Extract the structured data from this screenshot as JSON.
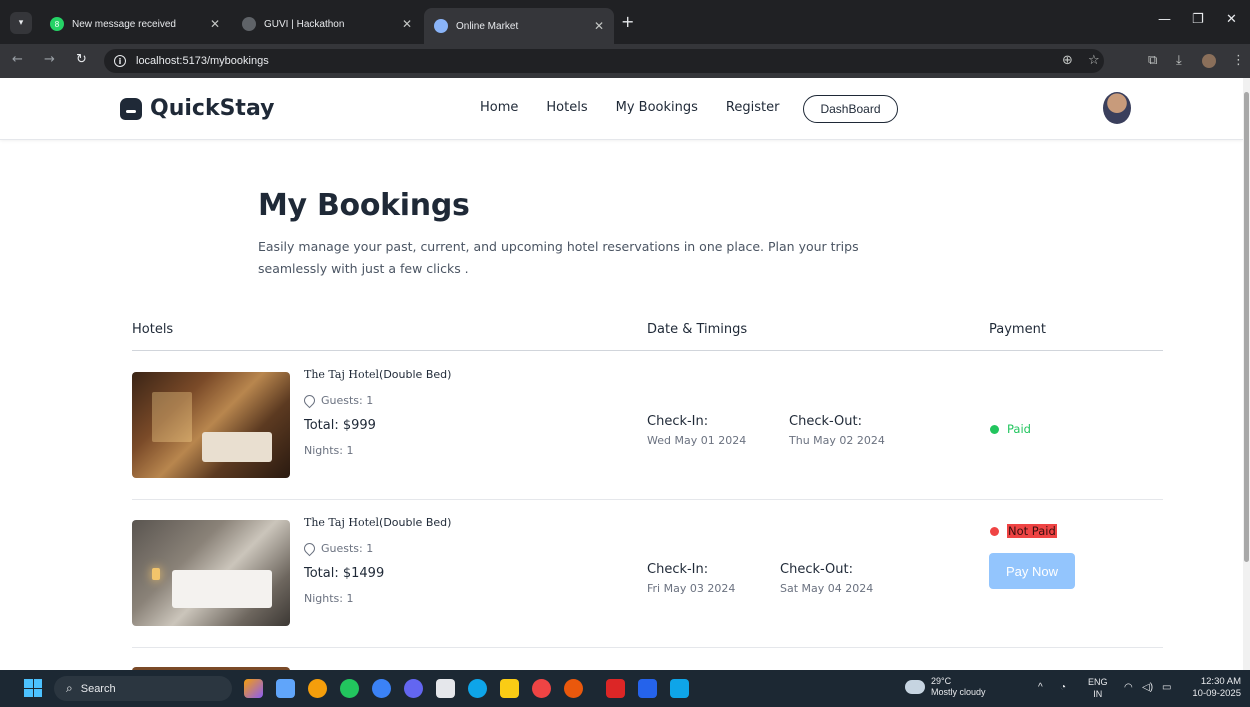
{
  "browser": {
    "tabs": [
      {
        "title": "New message received",
        "favicon_color": "#25d366",
        "favicon_text": "8"
      },
      {
        "title": "GUVI | Hackathon",
        "favicon_color": "#5f6368",
        "favicon_text": ""
      },
      {
        "title": "Online Market",
        "favicon_color": "#8ab4f8",
        "favicon_text": ""
      }
    ],
    "url": "localhost:5173/mybookings"
  },
  "site": {
    "brand": "QuickStay",
    "nav": [
      "Home",
      "Hotels",
      "My Bookings",
      "Register"
    ],
    "dashboard_label": "DashBoard",
    "title": "My Bookings",
    "subtitle": "Easily manage your past, current, and upcoming hotel reservations in one place. Plan your trips seamlessly with just a few clicks .",
    "columns": [
      "Hotels",
      "Date & Timings",
      "Payment"
    ],
    "bookings": [
      {
        "hotel": "The Taj Hotel",
        "room": "(Double Bed)",
        "guests": "Guests: 1",
        "total": "Total: $999",
        "nights": "Nights: 1",
        "checkin_label": "Check-In:",
        "checkin_date": "Wed May 01 2024",
        "checkout_label": "Check-Out:",
        "checkout_date": "Thu May 02 2024",
        "status": "Paid"
      },
      {
        "hotel": "The Taj Hotel",
        "room": "(Double Bed)",
        "guests": "Guests: 1",
        "total": "Total: $1499",
        "nights": "Nights: 1",
        "checkin_label": "Check-In:",
        "checkin_date": "Fri May 03 2024",
        "checkout_label": "Check-Out:",
        "checkout_date": "Sat May 04 2024",
        "status": "Not Paid",
        "pay_button": "Pay Now"
      }
    ]
  },
  "taskbar": {
    "search_label": "Search",
    "weather_temp": "29°C",
    "weather_desc": "Mostly cloudy",
    "lang_top": "ENG",
    "lang_bottom": "IN",
    "time": "12:30 AM",
    "date": "10-09-2025"
  },
  "colors": {
    "paid": "#22c55e",
    "not_paid": "#ef4444",
    "pay_button": "#93c5fd"
  }
}
